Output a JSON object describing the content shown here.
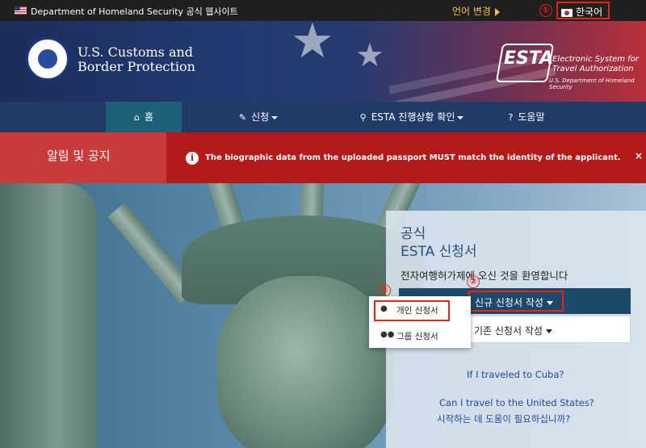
{
  "gov_bar": {
    "text": "Department of Homeland Security 공식 웹사이트",
    "language_change": "언어 변경",
    "current_language": "한국어",
    "marker_1": "①"
  },
  "header": {
    "agency_line1": "U.S. Customs and",
    "agency_line2": "Border Protection",
    "esta_logo_word": "ESTA",
    "esta_subtitle_1": "Electronic System for",
    "esta_subtitle_2": "Travel Authorization",
    "esta_dept": "U.S. Department of Homeland Security"
  },
  "nav": {
    "items": [
      {
        "label": "홈",
        "icon": "home-icon"
      },
      {
        "label": "신청",
        "icon": "pencil-icon"
      },
      {
        "label": "ESTA 진행상황 확인",
        "icon": "search-icon"
      },
      {
        "label": "도움말",
        "icon": "help-icon"
      }
    ]
  },
  "alert": {
    "heading": "알림 및 공지",
    "message": "The biographic data from the uploaded passport MUST match the identity of the applicant.",
    "close": "×"
  },
  "panel": {
    "title_1": "공식",
    "title_2": "ESTA 신청서",
    "welcome": "전자여행허가제에 오신 것을 환영합니다",
    "new_application": "신규 신청서 작성",
    "existing_application": "기존 신청서 작성",
    "cuba_link": "If I traveled to Cuba?",
    "travel_link": "Can I travel to the United States?",
    "help_link": "시작하는 데 도움이 필요하십니까?",
    "marker_2": "②"
  },
  "dropdown": {
    "individual": "개인 신청서",
    "group": "그룹 신청서",
    "marker_3": "③"
  }
}
